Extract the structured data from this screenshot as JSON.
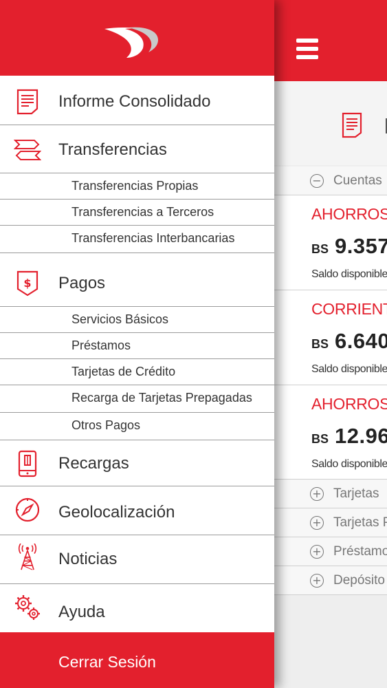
{
  "drawer": {
    "logo_icon": "bank-logo-swoosh",
    "menu": {
      "informe": {
        "label": "Informe Consolidado",
        "icon": "report-icon"
      },
      "transferencias": {
        "label": "Transferencias",
        "icon": "transfer-arrows-icon",
        "items": [
          "Transferencias Propias",
          "Transferencias a Terceros",
          "Transferencias Interbancarias"
        ]
      },
      "pagos": {
        "label": "Pagos",
        "icon": "dollar-tag-icon",
        "items": [
          "Servicios Básicos",
          "Préstamos",
          "Tarjetas de Crédito",
          "Recarga de Tarjetas Prepagadas",
          "Otros Pagos"
        ]
      },
      "recargas": {
        "label": "Recargas",
        "icon": "mobile-topup-icon"
      },
      "geolocalizacion": {
        "label": "Geolocalización",
        "icon": "compass-icon"
      },
      "noticias": {
        "label": "Noticias",
        "icon": "antenna-tower-icon"
      },
      "ayuda": {
        "label": "Ayuda",
        "icon": "gears-icon"
      }
    },
    "logout_label": "Cerrar Sesión"
  },
  "main": {
    "menu_icon": "hamburger-icon",
    "title_icon": "report-icon",
    "sections": {
      "cuentas": {
        "label": "Cuentas",
        "state": "−"
      },
      "tarjetas": {
        "label": "Tarjetas",
        "state": "+"
      },
      "tarjetas_p": {
        "label": "Tarjetas P",
        "state": "+"
      },
      "prestamos": {
        "label": "Préstamo",
        "state": "+"
      },
      "deposito": {
        "label": "Depósito c",
        "state": "+"
      }
    },
    "accounts": [
      {
        "name": "AHORROS",
        "currency": "BS",
        "amount": "9.357",
        "sub": "Saldo disponible"
      },
      {
        "name": "CORRIENTE",
        "currency": "BS",
        "amount": "6.640",
        "sub": "Saldo disponible"
      },
      {
        "name": "AHORROS B",
        "currency": "BS",
        "amount": "12.96",
        "sub": "Saldo disponible"
      }
    ]
  },
  "colors": {
    "brand_red": "#e3202d",
    "text_dark": "#333333",
    "divider": "#9a9a9a"
  }
}
